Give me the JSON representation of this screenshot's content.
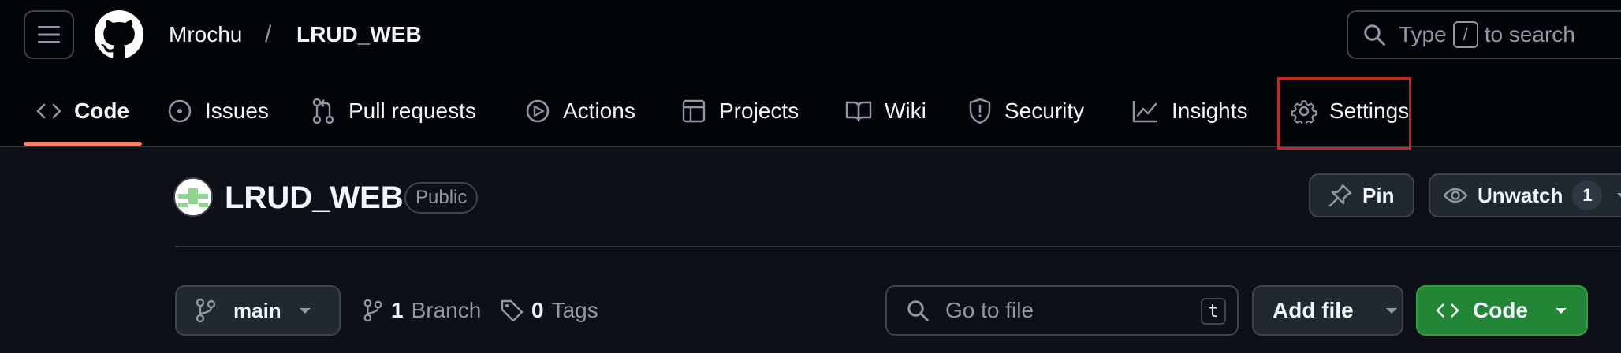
{
  "header": {
    "owner": "Mrochu",
    "separator": "/",
    "repo": "LRUD_WEB",
    "search": {
      "prefix": "Type",
      "key": "/",
      "suffix": "to search"
    }
  },
  "tabs": [
    {
      "label": "Code",
      "icon": "code-icon",
      "selected": true
    },
    {
      "label": "Issues",
      "icon": "issue-icon"
    },
    {
      "label": "Pull requests",
      "icon": "pull-request-icon"
    },
    {
      "label": "Actions",
      "icon": "play-icon"
    },
    {
      "label": "Projects",
      "icon": "table-icon"
    },
    {
      "label": "Wiki",
      "icon": "book-icon"
    },
    {
      "label": "Security",
      "icon": "shield-icon"
    },
    {
      "label": "Insights",
      "icon": "graph-icon"
    },
    {
      "label": "Settings",
      "icon": "gear-icon",
      "highlighted": true
    }
  ],
  "repo_header": {
    "title": "LRUD_WEB",
    "visibility": "Public",
    "pin_label": "Pin",
    "watch_label": "Unwatch",
    "watch_count": "1"
  },
  "toolbar": {
    "branch": "main",
    "branch_count": "1",
    "branch_label": "Branch",
    "tag_count": "0",
    "tag_label": "Tags",
    "goto_placeholder": "Go to file",
    "goto_shortcut": "t",
    "add_file_label": "Add file",
    "code_label": "Code"
  },
  "colors": {
    "accent_underline": "#f78166",
    "code_button": "#238636",
    "highlight_box": "#c42b1c"
  }
}
